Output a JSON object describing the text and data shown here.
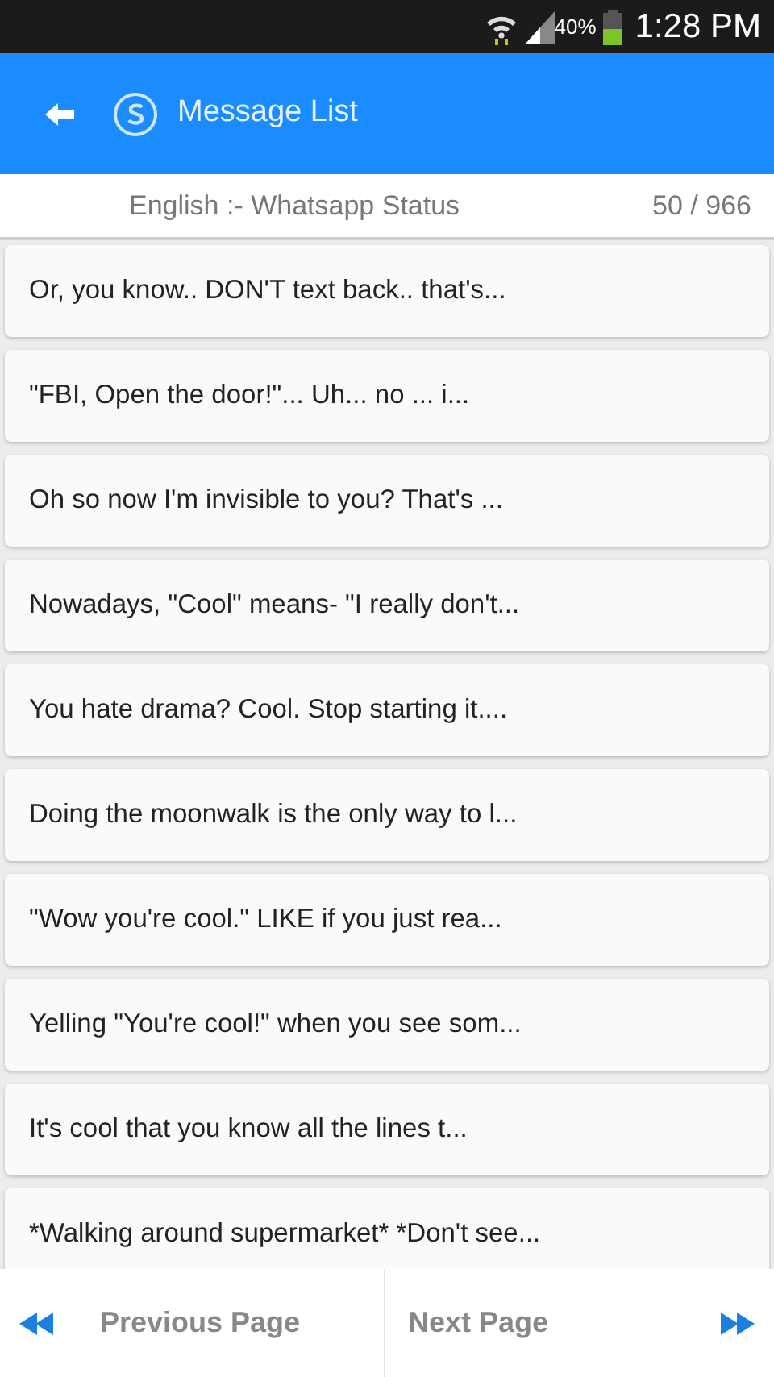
{
  "status_bar": {
    "battery": "40%",
    "time": "1:28 PM"
  },
  "app_bar": {
    "title": "Message List"
  },
  "subheader": {
    "category": "English :- Whatsapp Status",
    "count": "50 / 966"
  },
  "messages": [
    {
      "text": "Or, you know.. DON'T text back.. that's..."
    },
    {
      "text": "\"FBI, Open the door!\"... Uh... no ... i..."
    },
    {
      "text": "Oh so now I'm invisible to you? That's ..."
    },
    {
      "text": "Nowadays, \"Cool\" means- \"I really don't..."
    },
    {
      "text": "You hate drama? Cool. Stop starting it...."
    },
    {
      "text": "Doing the moonwalk is the only way to l..."
    },
    {
      "text": "\"Wow you're cool.\" LIKE if you just rea..."
    },
    {
      "text": "Yelling \"You're cool!\" when you see som..."
    },
    {
      "text": "It's cool that you know all the lines t..."
    },
    {
      "text": "*Walking around supermarket* *Don't see..."
    }
  ],
  "footer": {
    "previous": "Previous Page",
    "next": "Next Page"
  }
}
